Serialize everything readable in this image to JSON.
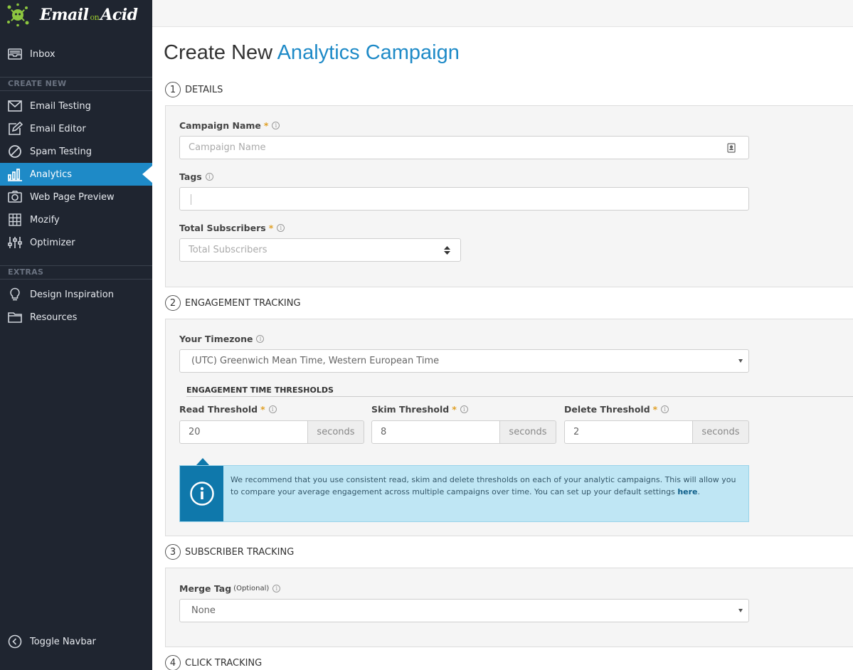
{
  "brand": {
    "name_left": "Email",
    "name_mid": "on",
    "name_right": "Acid"
  },
  "sidebar": {
    "inbox": "Inbox",
    "create_new_label": "CREATE NEW",
    "create_items": [
      {
        "label": "Email Testing",
        "icon": "envelope-icon"
      },
      {
        "label": "Email Editor",
        "icon": "edit-icon"
      },
      {
        "label": "Spam Testing",
        "icon": "ban-icon"
      },
      {
        "label": "Analytics",
        "icon": "bar-chart-icon",
        "active": true
      },
      {
        "label": "Web Page Preview",
        "icon": "camera-icon"
      },
      {
        "label": "Mozify",
        "icon": "grid-icon"
      },
      {
        "label": "Optimizer",
        "icon": "sliders-icon"
      }
    ],
    "extras_label": "EXTRAS",
    "extras_items": [
      {
        "label": "Design Inspiration",
        "icon": "lightbulb-icon"
      },
      {
        "label": "Resources",
        "icon": "folder-icon"
      }
    ],
    "toggle": "Toggle Navbar"
  },
  "page": {
    "title_plain": "Create New",
    "title_accent": "Analytics Campaign"
  },
  "steps": {
    "details": {
      "num": "1",
      "title": "DETAILS"
    },
    "engagement": {
      "num": "2",
      "title": "ENGAGEMENT TRACKING"
    },
    "subscriber": {
      "num": "3",
      "title": "SUBSCRIBER TRACKING"
    },
    "click": {
      "num": "4",
      "title": "CLICK TRACKING"
    }
  },
  "details": {
    "campaign_name_label": "Campaign Name",
    "campaign_name_placeholder": "Campaign Name",
    "tags_label": "Tags",
    "tags_value": "",
    "total_subscribers_label": "Total Subscribers",
    "total_subscribers_placeholder": "Total Subscribers",
    "required_mark": "*"
  },
  "engagement": {
    "timezone_label": "Your Timezone",
    "timezone_value": "(UTC) Greenwich Mean Time, Western European Time",
    "thresholds_heading": "ENGAGEMENT TIME THRESHOLDS",
    "read_label": "Read Threshold",
    "read_value": "20",
    "skim_label": "Skim Threshold",
    "skim_value": "8",
    "delete_label": "Delete Threshold",
    "delete_value": "2",
    "unit": "seconds",
    "callout_text": "We recommend that you use consistent read, skim and delete thresholds on each of your analytic campaigns. This will allow you to compare your average engagement across multiple campaigns over time. You can set up your default settings ",
    "callout_link": "here",
    "callout_end": "."
  },
  "subscriber": {
    "merge_tag_label": "Merge Tag",
    "merge_tag_optional": "(Optional)",
    "merge_tag_value": "None"
  },
  "colors": {
    "sidebar_bg": "#1f2530",
    "accent": "#1e8ac7",
    "required": "#e0a026",
    "callout_bg": "#bfe6f4"
  }
}
